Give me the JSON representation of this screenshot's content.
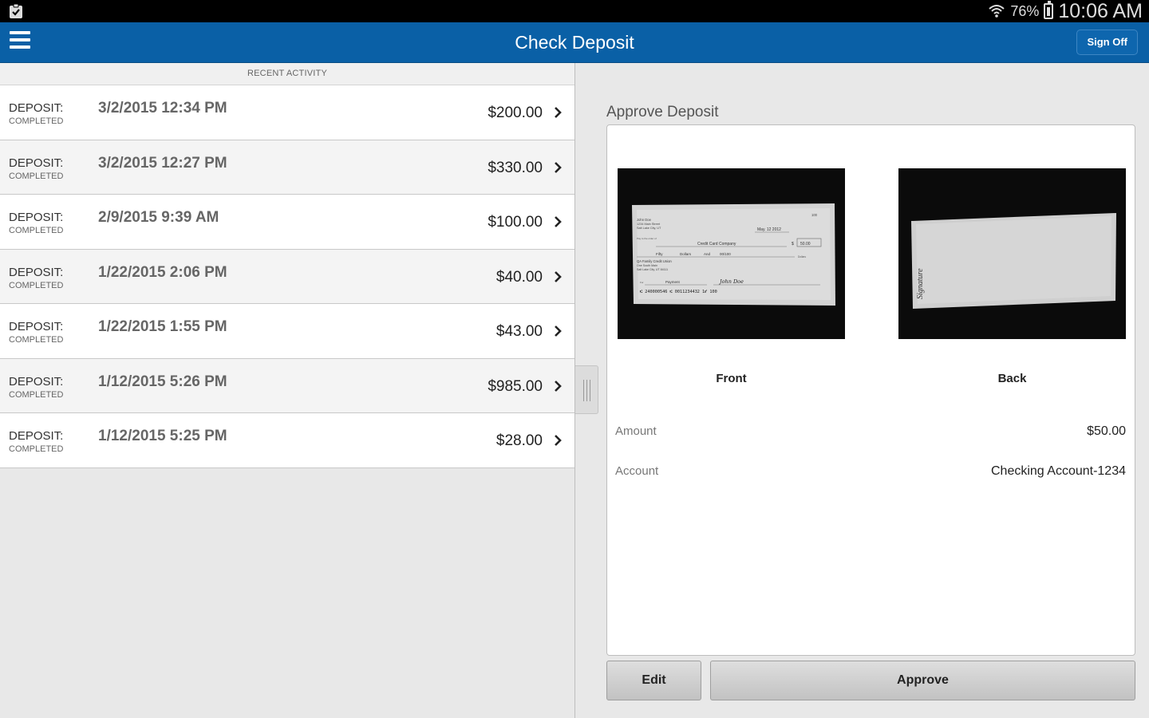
{
  "status_bar": {
    "battery_percent": "76%",
    "time": "10:06 AM"
  },
  "app_bar": {
    "title": "Check Deposit",
    "sign_off_label": "Sign Off"
  },
  "recent_activity": {
    "header": "RECENT ACTIVITY",
    "items": [
      {
        "type": "DEPOSIT:",
        "status": "COMPLETED",
        "date": "3/2/2015 12:34 PM",
        "amount": "$200.00"
      },
      {
        "type": "DEPOSIT:",
        "status": "COMPLETED",
        "date": "3/2/2015 12:27 PM",
        "amount": "$330.00"
      },
      {
        "type": "DEPOSIT:",
        "status": "COMPLETED",
        "date": "2/9/2015 9:39 AM",
        "amount": "$100.00"
      },
      {
        "type": "DEPOSIT:",
        "status": "COMPLETED",
        "date": "1/22/2015 2:06 PM",
        "amount": "$40.00"
      },
      {
        "type": "DEPOSIT:",
        "status": "COMPLETED",
        "date": "1/22/2015 1:55 PM",
        "amount": "$43.00"
      },
      {
        "type": "DEPOSIT:",
        "status": "COMPLETED",
        "date": "1/12/2015 5:26 PM",
        "amount": "$985.00"
      },
      {
        "type": "DEPOSIT:",
        "status": "COMPLETED",
        "date": "1/12/2015 5:25 PM",
        "amount": "$28.00"
      }
    ]
  },
  "approve_deposit": {
    "title": "Approve Deposit",
    "front_label": "Front",
    "back_label": "Back",
    "amount_label": "Amount",
    "amount_value": "$50.00",
    "account_label": "Account",
    "account_value": "Checking Account-1234",
    "edit_label": "Edit",
    "approve_label": "Approve"
  },
  "check_front": {
    "name": "John Doe",
    "address1": "1234 Main Street",
    "address2": "Salt Lake City, UT",
    "number": "100",
    "date": "May. 12 2012",
    "pay_to_prefix": "Pay to the order of",
    "payee": "Credit Card Company",
    "currency_symbol": "$",
    "amount_box": "50.00",
    "amount_words_1": "Fifty",
    "amount_words_2": "Dollars",
    "amount_words_3": "And",
    "amount_words_4": "00/100",
    "dollars_label": "Dollars",
    "bank_name": "QA Family Credit Union",
    "bank_address1": "One South Main",
    "bank_address2": "Salt Lake City, UT 84111",
    "memo_prefix": "For",
    "memo": "Payment",
    "signature": "John Doe",
    "micr": "⑆ 240000546 ⑆ 0011234432 1⑈ 100"
  },
  "check_back": {
    "endorsement": "Signature"
  },
  "colors": {
    "app_bar": "#0a60a6",
    "panel_bg": "#e8e8e8"
  }
}
